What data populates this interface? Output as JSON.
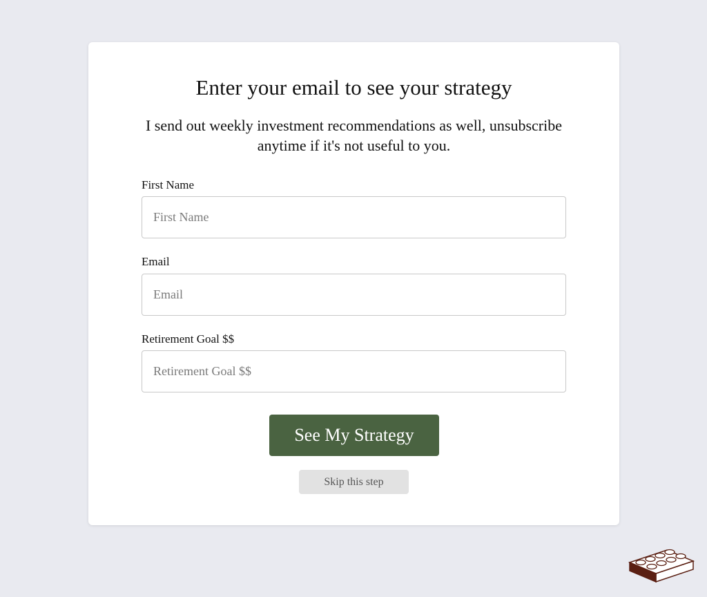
{
  "form": {
    "title": "Enter your email to see your strategy",
    "subtitle": "I send out weekly investment recommendations as well, unsubscribe anytime if it's not useful to you.",
    "fields": [
      {
        "label": "First Name",
        "placeholder": "First Name",
        "value": ""
      },
      {
        "label": "Email",
        "placeholder": "Email",
        "value": ""
      },
      {
        "label": "Retirement Goal $$",
        "placeholder": "Retirement Goal $$",
        "value": ""
      }
    ],
    "submit_label": "See My Strategy",
    "skip_label": "Skip this step"
  },
  "colors": {
    "page_background": "#e9eaf0",
    "card_background": "#ffffff",
    "primary_button": "#4a6341",
    "skip_button": "#e2e2e2",
    "brick": "#5a1f12"
  },
  "icons": {
    "corner_badge": "lego-brick-icon"
  }
}
